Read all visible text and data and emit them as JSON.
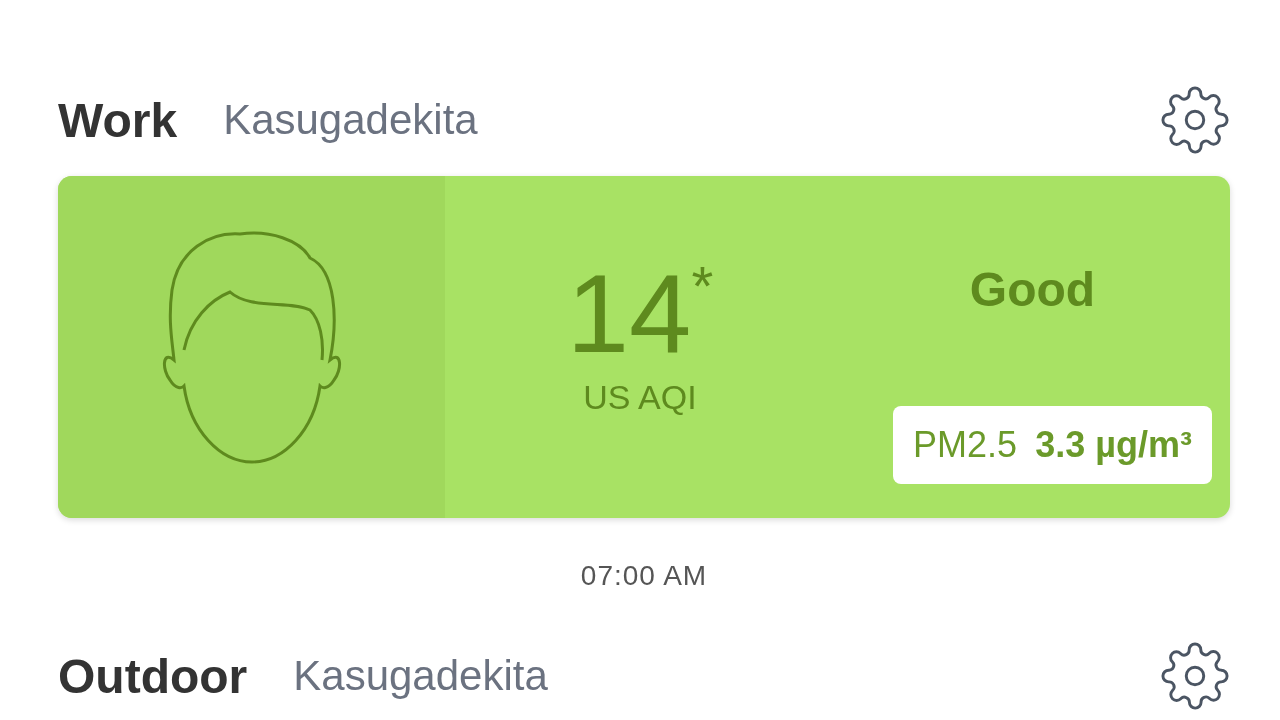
{
  "sections": [
    {
      "title": "Work",
      "location": "Kasugadekita",
      "card": {
        "aqi": "14",
        "aqi_mark": "*",
        "unit": "US AQI",
        "status": "Good",
        "pollutant": {
          "name": "PM2.5",
          "value": "3.3 µg/m³"
        }
      },
      "time": "07:00 AM"
    },
    {
      "title": "Outdoor",
      "location": "Kasugadekita"
    }
  ]
}
